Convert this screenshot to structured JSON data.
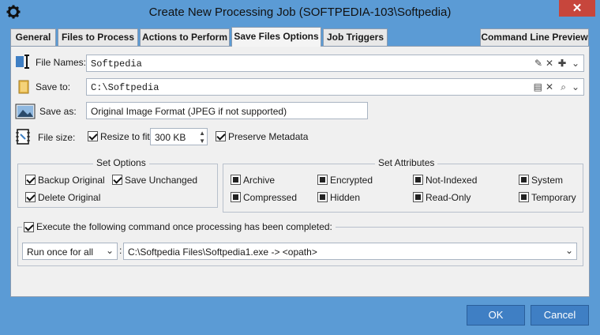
{
  "window": {
    "title": "Create New Processing Job (SOFTPEDIA-103\\Softpedia)",
    "close_label": "✕"
  },
  "tabs": [
    {
      "label": "General"
    },
    {
      "label": "Files to Process"
    },
    {
      "label": "Actions to Perform"
    },
    {
      "label": "Save Files Options"
    },
    {
      "label": "Job Triggers"
    },
    {
      "label": "Command Line Preview"
    }
  ],
  "file_names": {
    "label": "File Names:",
    "value": "Softpedia"
  },
  "save_to": {
    "label": "Save to:",
    "value": "C:\\Softpedia"
  },
  "save_as": {
    "label": "Save as:",
    "value": "Original Image Format (JPEG if not supported)"
  },
  "file_size": {
    "label": "File size:",
    "resize_label": "Resize to fit:",
    "resize_checked": true,
    "size_value": "300 KB",
    "preserve_label": "Preserve Metadata",
    "preserve_checked": true
  },
  "set_options": {
    "title": "Set Options",
    "backup_original": "Backup Original",
    "save_unchanged": "Save Unchanged",
    "delete_original": "Delete Original"
  },
  "set_attributes": {
    "title": "Set Attributes",
    "archive": "Archive",
    "encrypted": "Encrypted",
    "not_indexed": "Not-Indexed",
    "system": "System",
    "compressed": "Compressed",
    "hidden": "Hidden",
    "read_only": "Read-Only",
    "temporary": "Temporary"
  },
  "execute": {
    "label": "Execute the following command once processing has been completed:",
    "run_mode": "Run once for all",
    "separator": ":",
    "command": "C:\\Softpedia Files\\Softpedia1.exe -> <opath>"
  },
  "buttons": {
    "ok": "OK",
    "cancel": "Cancel"
  },
  "colors": {
    "accent": "#3f7fc4",
    "titlebar": "#5b9bd5",
    "close": "#c7463c"
  }
}
